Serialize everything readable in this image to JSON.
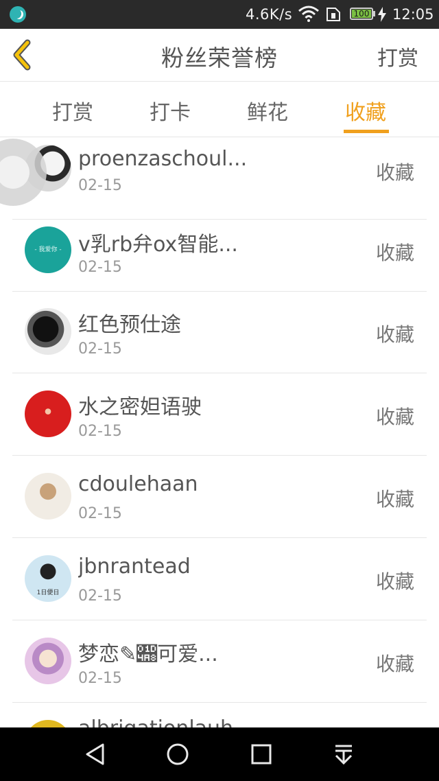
{
  "status_bar": {
    "net_speed": "4.6K/s",
    "battery": "100",
    "time": "12:05"
  },
  "header": {
    "title": "粉丝荣誉榜",
    "action_label": "打赏",
    "back_icon": "chevron-left-icon"
  },
  "tabs": [
    {
      "label": "打赏",
      "active": false
    },
    {
      "label": "打卡",
      "active": false
    },
    {
      "label": "鲜花",
      "active": false
    },
    {
      "label": "收藏",
      "active": true
    }
  ],
  "accent_color": "#f0a01e",
  "rows": [
    {
      "name": "proenzaschoul...",
      "date": "02-15",
      "action": "收藏",
      "avatar_color": "#cfcfcf"
    },
    {
      "name": "v乳rb弁ox智能...",
      "date": "02-15",
      "action": "收藏",
      "avatar_color": "#1aa39a",
      "avatar_text": "- 我爱你 -"
    },
    {
      "name": "红色预仕途",
      "date": "02-15",
      "action": "收藏",
      "avatar_color": "#2b2b2b"
    },
    {
      "name": "水之密妲语驶",
      "date": "02-15",
      "action": "收藏",
      "avatar_color": "#d81e1e"
    },
    {
      "name": "cdoulehaan",
      "date": "02-15",
      "action": "收藏",
      "avatar_color": "#e8e2d6"
    },
    {
      "name": "jbnrantead",
      "date": "02-15",
      "action": "收藏",
      "avatar_color": "#cfe6f2",
      "avatar_text": "1日便日"
    },
    {
      "name": "梦恋✎𝒨可爱...",
      "date": "02-15",
      "action": "收藏",
      "avatar_color": "#e7c6e7"
    },
    {
      "name": "albrigationlauh",
      "date": "",
      "action": "",
      "avatar_color": "#e0b820"
    }
  ]
}
